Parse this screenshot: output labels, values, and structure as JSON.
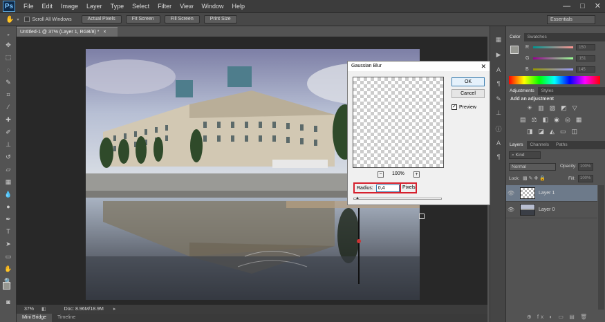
{
  "app": {
    "logo": "Ps"
  },
  "menu": [
    "File",
    "Edit",
    "Image",
    "Layer",
    "Type",
    "Select",
    "Filter",
    "View",
    "Window",
    "Help"
  ],
  "window_controls": {
    "minimize": "—",
    "maximize": "□",
    "close": "✕"
  },
  "options_bar": {
    "scroll_all_windows": "Scroll All Windows",
    "buttons": [
      "Actual Pixels",
      "Fit Screen",
      "Fill Screen",
      "Print Size"
    ],
    "workspace": "Essentials"
  },
  "document": {
    "tab_title": "Untitled-1 @ 37% (Layer 1, RGB/8) *",
    "tab_close": "×",
    "zoom": "37%",
    "doc_size": "Doc: 8.96M/18.9M"
  },
  "bottom_tabs": [
    "Mini Bridge",
    "Timeline"
  ],
  "dialog": {
    "title": "Gaussian Blur",
    "close": "✕",
    "ok": "OK",
    "cancel": "Cancel",
    "preview_label": "Preview",
    "preview_checked": true,
    "zoom_minus": "−",
    "zoom_plus": "+",
    "zoom_level": "100%",
    "radius_label": "Radius:",
    "radius_value": "0,4",
    "units": "Pixels"
  },
  "color_panel": {
    "tabs": [
      "Color",
      "Swatches"
    ],
    "channels": [
      {
        "label": "R",
        "value": "150"
      },
      {
        "label": "G",
        "value": "151"
      },
      {
        "label": "B",
        "value": "145"
      }
    ]
  },
  "adjustments_panel": {
    "tabs": [
      "Adjustments",
      "Styles"
    ],
    "heading": "Add an adjustment"
  },
  "layers_panel": {
    "tabs": [
      "Layers",
      "Channels",
      "Paths"
    ],
    "kind": "Kind",
    "blend_mode": "Normal",
    "opacity_label": "Opacity:",
    "opacity_value": "100%",
    "lock_label": "Lock:",
    "fill_label": "Fill:",
    "fill_value": "100%",
    "layers": [
      {
        "name": "Layer 1",
        "selected": true
      },
      {
        "name": "Layer 0",
        "selected": false
      }
    ],
    "footer_icons": "⊕ fx ◐ ▭ ▤ 🗑"
  }
}
